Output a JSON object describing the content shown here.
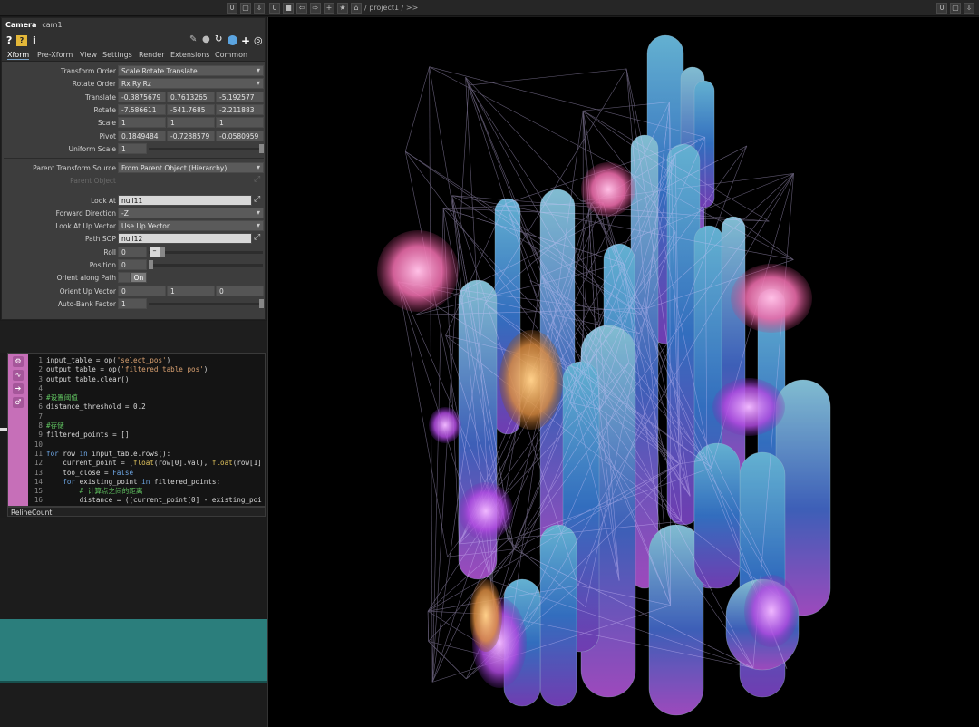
{
  "topbar": {
    "left_buttons": [
      "0",
      "▢",
      "⇩"
    ],
    "nav_buttons": [
      "■",
      "⇦",
      "⇨",
      "+",
      "★",
      "⌂"
    ],
    "path": "/ project1 / >>",
    "right_buttons": [
      "0",
      "▢",
      "⇩"
    ]
  },
  "operator": {
    "type": "Camera",
    "name": "cam1"
  },
  "tabs": [
    "Xform",
    "Pre-Xform",
    "View",
    "Settings",
    "Render",
    "Extensions",
    "Common"
  ],
  "active_tab": "Xform",
  "params": {
    "transform_order": {
      "label": "Transform Order",
      "value": "Scale Rotate Translate"
    },
    "rotate_order": {
      "label": "Rotate Order",
      "value": "Rx Ry Rz"
    },
    "translate": {
      "label": "Translate",
      "values": [
        "-0.3875679",
        "0.7613265",
        "-5.192577"
      ]
    },
    "rotate": {
      "label": "Rotate",
      "values": [
        "-7.586611",
        "-541.7685",
        "-2.211883"
      ]
    },
    "scale": {
      "label": "Scale",
      "values": [
        "1",
        "1",
        "1"
      ]
    },
    "pivot": {
      "label": "Pivot",
      "values": [
        "0.1849484",
        "-0.7288579",
        "-0.0580959"
      ]
    },
    "uniform_scale": {
      "label": "Uniform Scale",
      "value": "1"
    },
    "parent_transform_source": {
      "label": "Parent Transform Source",
      "value": "From Parent Object (Hierarchy)"
    },
    "parent_object": {
      "label": "Parent Object"
    },
    "look_at": {
      "label": "Look At",
      "value": "null11"
    },
    "forward_direction": {
      "label": "Forward Direction",
      "value": "-Z"
    },
    "look_at_up_vector": {
      "label": "Look At Up Vector",
      "value": "Use Up Vector"
    },
    "path_sop": {
      "label": "Path SOP",
      "value": "null12"
    },
    "roll": {
      "label": "Roll",
      "value": "0"
    },
    "position": {
      "label": "Position",
      "value": "0"
    },
    "orient_along_path": {
      "label": "Orient along Path",
      "value": "On"
    },
    "orient_up_vector": {
      "label": "Orient Up Vector",
      "values": [
        "0",
        "1",
        "0"
      ]
    },
    "auto_bank_factor": {
      "label": "Auto-Bank Factor",
      "value": "1"
    }
  },
  "code": {
    "lines": [
      {
        "n": "1",
        "html": "input_table = op(<span class='st'>'select_pos'</span>)"
      },
      {
        "n": "2",
        "html": "output_table = op(<span class='st'>'filtered_table_pos'</span>)"
      },
      {
        "n": "3",
        "html": "output_table.clear()"
      },
      {
        "n": "4",
        "html": ""
      },
      {
        "n": "5",
        "html": "<span class='cm'>#设置阈值</span>"
      },
      {
        "n": "6",
        "html": "distance_threshold = 0.2"
      },
      {
        "n": "7",
        "html": ""
      },
      {
        "n": "8",
        "html": "<span class='cm'>#存储</span>"
      },
      {
        "n": "9",
        "html": "filtered_points = []"
      },
      {
        "n": "10",
        "html": ""
      },
      {
        "n": "11",
        "html": "<span class='kw'>for</span> row <span class='kw'>in</span> input_table.rows():"
      },
      {
        "n": "12",
        "html": "    current_point = [<span class='fl'>float</span>(row[0].val), <span class='fl'>float</span>(row[1]"
      },
      {
        "n": "13",
        "html": "    too_close = <span class='kw'>False</span>"
      },
      {
        "n": "14",
        "html": "    <span class='kw'>for</span> existing_point <span class='kw'>in</span> filtered_points:"
      },
      {
        "n": "15",
        "html": "        <span class='cm'># 计算点之间的距离</span>"
      },
      {
        "n": "16",
        "html": "        distance = ((current_point[0] - existing_poi"
      }
    ],
    "footer": "RelineCount"
  },
  "colors": {
    "accent": "#c66fb8",
    "teal": "#2b7e7c",
    "panel": "#3d3d3d"
  }
}
